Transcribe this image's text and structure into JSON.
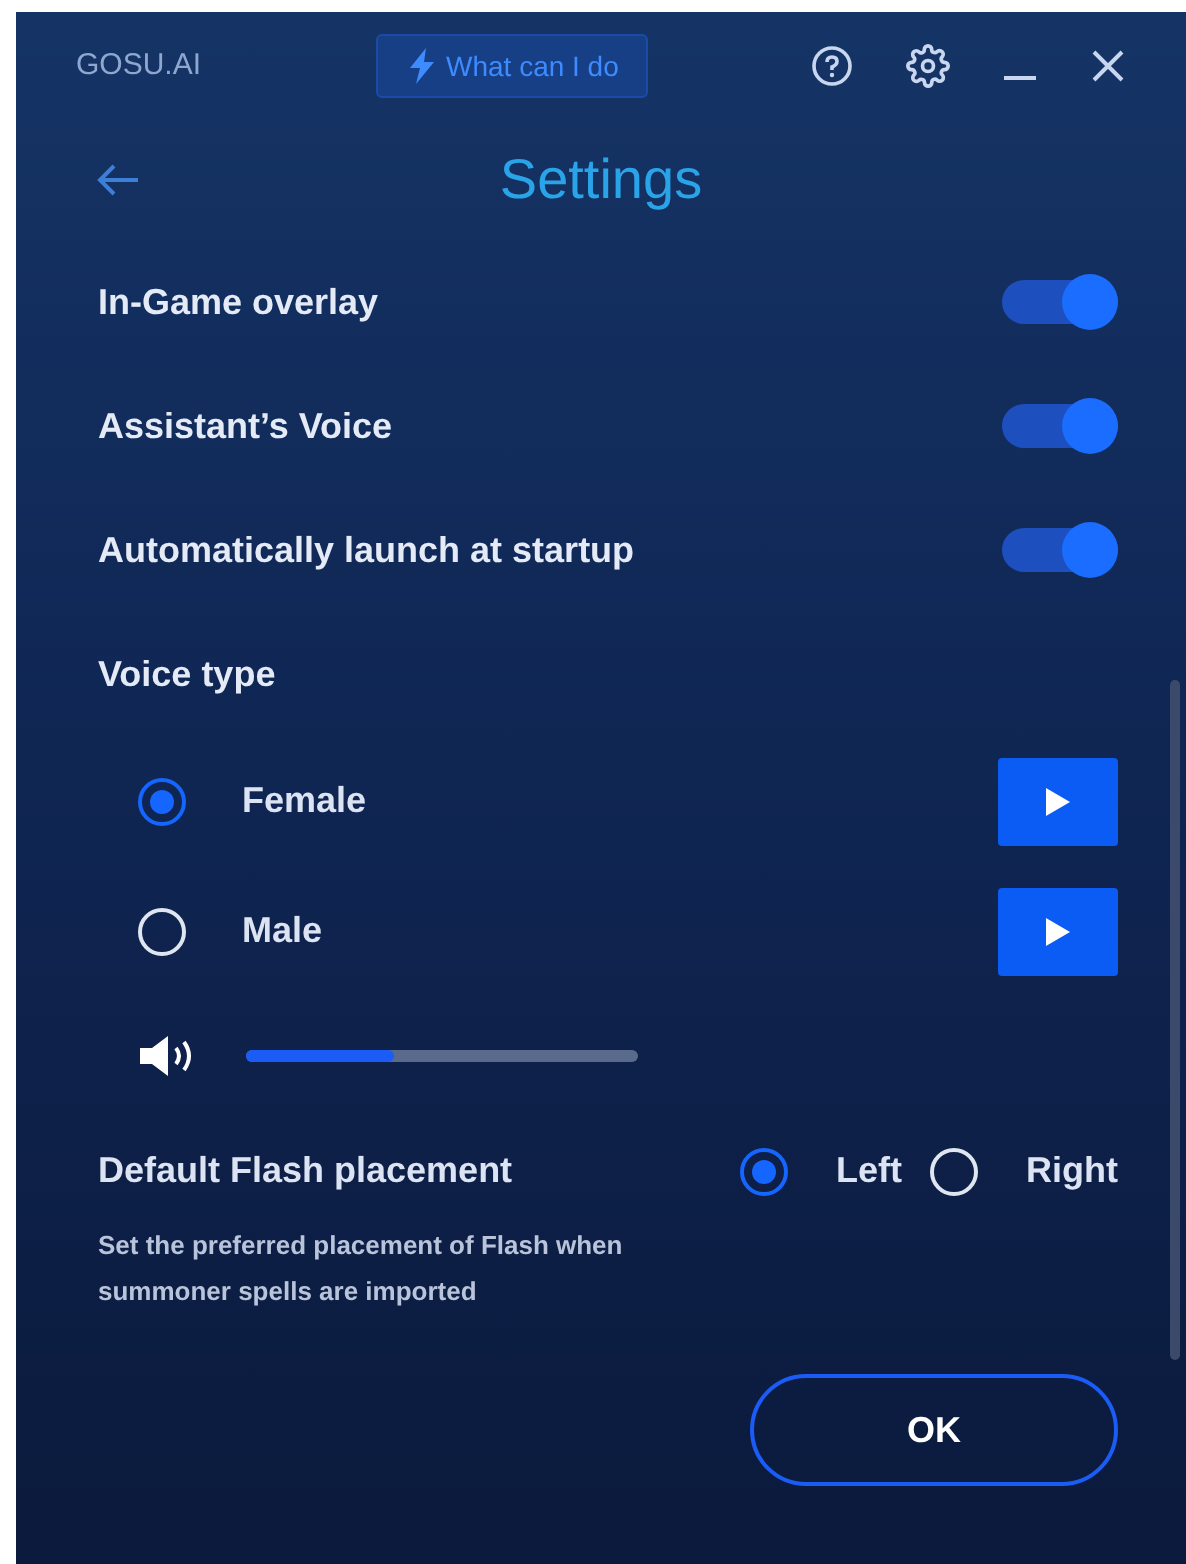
{
  "app_title": "GOSU.AI",
  "help_button": {
    "label": "What can I do"
  },
  "page_title": "Settings",
  "toggles": [
    {
      "label": "In-Game overlay",
      "on": true
    },
    {
      "label": "Assistant’s Voice",
      "on": true
    },
    {
      "label": "Automatically launch at startup",
      "on": true
    }
  ],
  "voice_type": {
    "label": "Voice type",
    "options": [
      {
        "label": "Female",
        "selected": true
      },
      {
        "label": "Male",
        "selected": false
      }
    ],
    "volume": {
      "level": 0.38
    }
  },
  "flash": {
    "label": "Default Flash placement",
    "description": "Set the preferred placement of Flash when summoner spells are imported",
    "options": [
      {
        "label": "Left",
        "selected": true
      },
      {
        "label": "Right",
        "selected": false
      }
    ]
  },
  "ok_button": "OK"
}
